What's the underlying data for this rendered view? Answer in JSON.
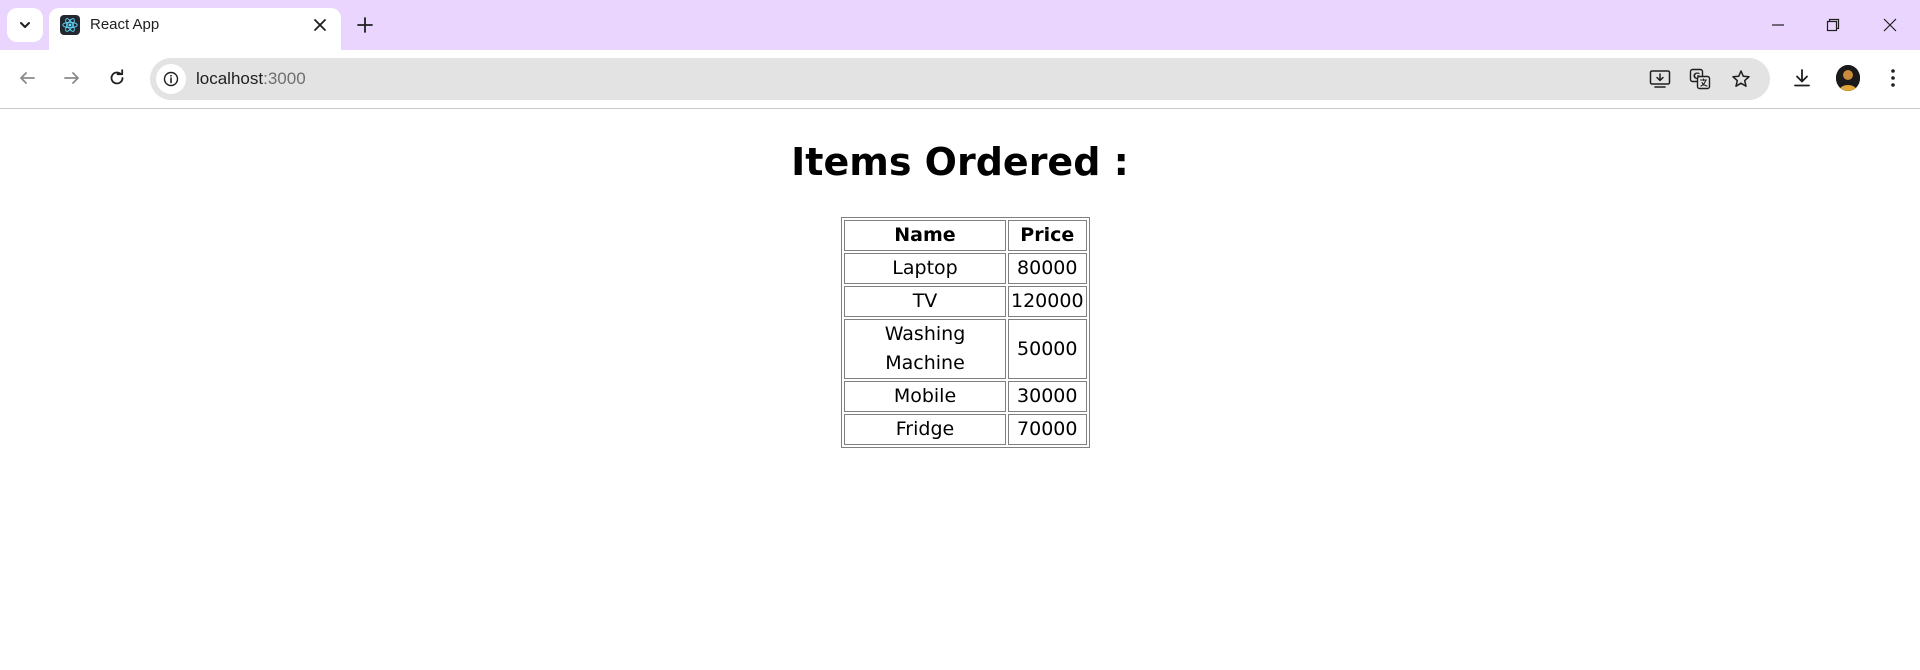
{
  "browser": {
    "tab": {
      "title": "React App",
      "favicon": "react-logo-icon"
    },
    "address": {
      "host": "localhost",
      "port": ":3000"
    },
    "colors": {
      "tabstrip": "#e9d5fd",
      "omnibox": "#e3e3e3",
      "react_blue": "#61dafb"
    }
  },
  "page": {
    "heading": "Items Ordered :",
    "table": {
      "headers": [
        "Name",
        "Price"
      ],
      "rows": [
        [
          "Laptop",
          "80000"
        ],
        [
          "TV",
          "120000"
        ],
        [
          "Washing Machine",
          "50000"
        ],
        [
          "Mobile",
          "30000"
        ],
        [
          "Fridge",
          "70000"
        ]
      ]
    }
  }
}
